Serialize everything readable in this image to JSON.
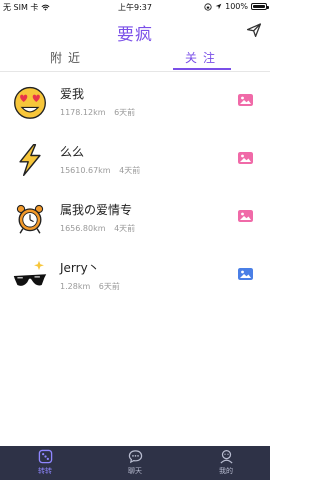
{
  "status_bar": {
    "carrier": "无 SIM 卡",
    "time": "上午9:37",
    "battery_text": "100%",
    "battery_level": 1.0
  },
  "header": {
    "title": "要疯",
    "send_icon": "send-icon"
  },
  "tabs": [
    {
      "label": "附近",
      "active": false
    },
    {
      "label": "关注",
      "active": true
    }
  ],
  "users": [
    {
      "name": "爱我",
      "distance": "1178.12km",
      "time": "6天前",
      "avatar": "heart-eyes-emoji",
      "image_color": "#f06aa8"
    },
    {
      "name": "么么",
      "distance": "15610.67km",
      "time": "4天前",
      "avatar": "lightning-bolt",
      "image_color": "#f06aa8"
    },
    {
      "name": "属我の爱情专",
      "distance": "1656.80km",
      "time": "4天前",
      "avatar": "clock-character",
      "image_color": "#f06aa8"
    },
    {
      "name": "Jerry丶",
      "distance": "1.28km",
      "time": "6天前",
      "avatar": "sunglasses",
      "image_color": "#4a7fe6"
    }
  ],
  "bottom_nav": [
    {
      "label": "转转",
      "icon": "dice-icon",
      "active": true
    },
    {
      "label": "聊天",
      "icon": "chat-icon",
      "active": false
    },
    {
      "label": "我的",
      "icon": "profile-icon",
      "active": false
    }
  ],
  "colors": {
    "accent": "#7a4fe8",
    "bottom_bar": "#2e3247"
  }
}
